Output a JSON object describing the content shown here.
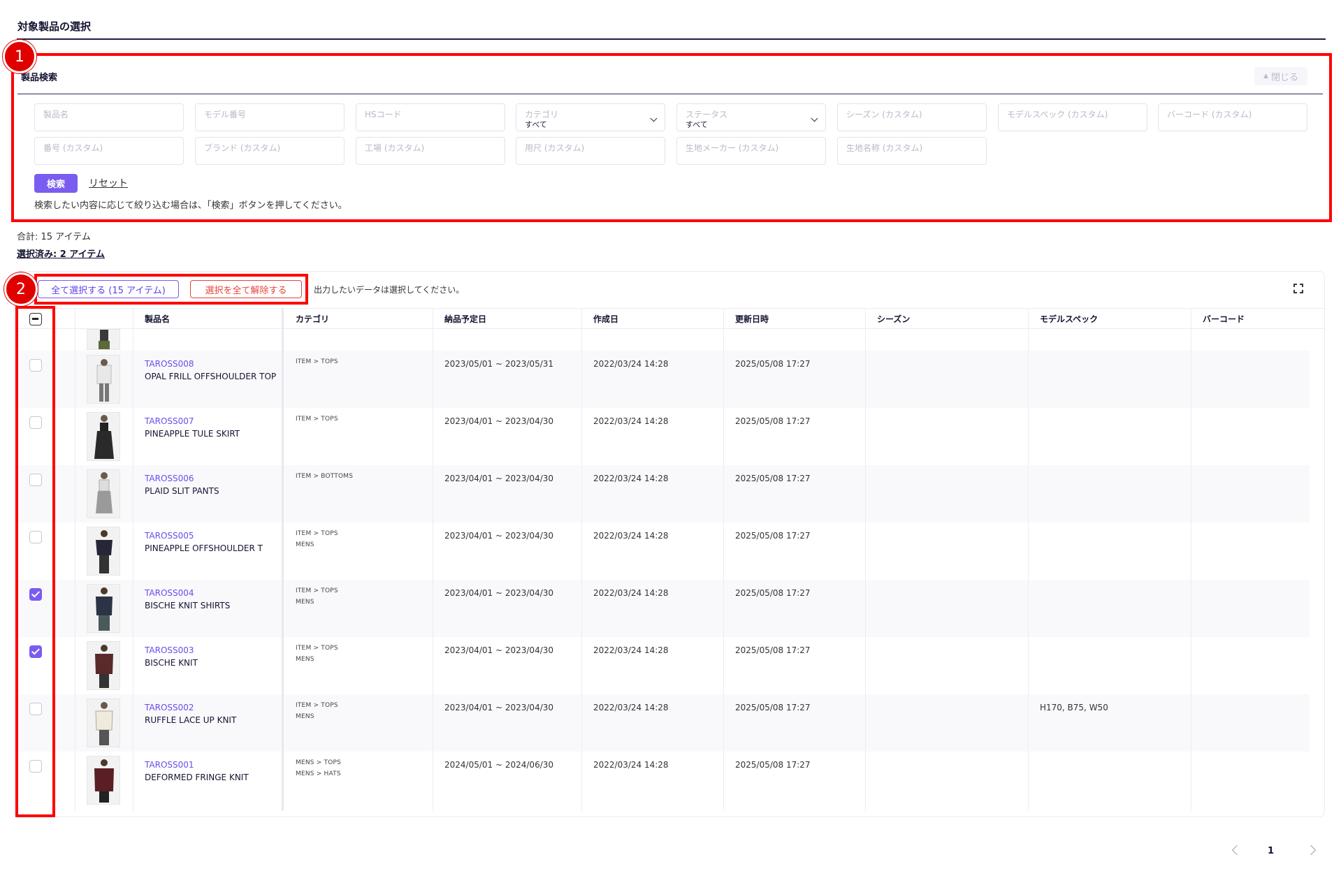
{
  "page": {
    "title": "対象製品の選択"
  },
  "search": {
    "heading": "製品検索",
    "close_label": "閉じる",
    "fields": [
      {
        "placeholder": "製品名"
      },
      {
        "placeholder": "モデル番号"
      },
      {
        "placeholder": "HSコード"
      },
      {
        "placeholder": "カテゴリ",
        "value": "すべて"
      },
      {
        "placeholder": "ステータス",
        "value": "すべて"
      },
      {
        "placeholder": "シーズン (カスタム)"
      },
      {
        "placeholder": "モデルスペック (カスタム)"
      },
      {
        "placeholder": "バーコード (カスタム)"
      },
      {
        "placeholder": "番号 (カスタム)"
      },
      {
        "placeholder": "ブランド (カスタム)"
      },
      {
        "placeholder": "工場 (カスタム)"
      },
      {
        "placeholder": "用尺 (カスタム)"
      },
      {
        "placeholder": "生地メーカー (カスタム)"
      },
      {
        "placeholder": "生地名称 (カスタム)"
      }
    ],
    "search_label": "検索",
    "reset_label": "リセット",
    "hint": "検索したい内容に応じて絞り込む場合は、「検索」ボタンを押してください。"
  },
  "summary": {
    "total": "合計: 15 アイテム",
    "selected": "選択済み: 2 アイテム"
  },
  "toolbar": {
    "select_all_label": "全て選択する (15 アイテム)",
    "deselect_all_label": "選択を全て解除する",
    "hint": "出力したいデータは選択してください。"
  },
  "table": {
    "headers": [
      "製品名",
      "カテゴリ",
      "納品予定日",
      "作成日",
      "更新日時",
      "シーズン",
      "モデルスペック",
      "バーコード"
    ],
    "rows": [
      {
        "code": "TAROSS008",
        "name": "OPAL FRILL OFFSHOULDER TOP",
        "cat1": "ITEM > TOPS",
        "cat2": "",
        "delivery": "2023/05/01 ~ 2023/05/31",
        "created": "2022/03/24 14:28",
        "updated": "2025/05/08 17:27",
        "season": "",
        "spec": "",
        "barcode": "",
        "checked": false
      },
      {
        "code": "TAROSS007",
        "name": "PINEAPPLE TULE SKIRT",
        "cat1": "ITEM > TOPS",
        "cat2": "",
        "delivery": "2023/04/01 ~ 2023/04/30",
        "created": "2022/03/24 14:28",
        "updated": "2025/05/08 17:27",
        "season": "",
        "spec": "",
        "barcode": "",
        "checked": false
      },
      {
        "code": "TAROSS006",
        "name": "PLAID SLIT PANTS",
        "cat1": "ITEM > BOTTOMS",
        "cat2": "",
        "delivery": "2023/04/01 ~ 2023/04/30",
        "created": "2022/03/24 14:28",
        "updated": "2025/05/08 17:27",
        "season": "",
        "spec": "",
        "barcode": "",
        "checked": false
      },
      {
        "code": "TAROSS005",
        "name": "PINEAPPLE OFFSHOULDER T",
        "cat1": "ITEM > TOPS",
        "cat2": "MENS",
        "delivery": "2023/04/01 ~ 2023/04/30",
        "created": "2022/03/24 14:28",
        "updated": "2025/05/08 17:27",
        "season": "",
        "spec": "",
        "barcode": "",
        "checked": false
      },
      {
        "code": "TAROSS004",
        "name": "BISCHE KNIT SHIRTS",
        "cat1": "ITEM > TOPS",
        "cat2": "MENS",
        "delivery": "2023/04/01 ~ 2023/04/30",
        "created": "2022/03/24 14:28",
        "updated": "2025/05/08 17:27",
        "season": "",
        "spec": "",
        "barcode": "",
        "checked": true
      },
      {
        "code": "TAROSS003",
        "name": "BISCHE KNIT",
        "cat1": "ITEM > TOPS",
        "cat2": "MENS",
        "delivery": "2023/04/01 ~ 2023/04/30",
        "created": "2022/03/24 14:28",
        "updated": "2025/05/08 17:27",
        "season": "",
        "spec": "",
        "barcode": "",
        "checked": true
      },
      {
        "code": "TAROSS002",
        "name": "RUFFLE LACE UP KNIT",
        "cat1": "ITEM > TOPS",
        "cat2": "MENS",
        "delivery": "2023/04/01 ~ 2023/04/30",
        "created": "2022/03/24 14:28",
        "updated": "2025/05/08 17:27",
        "season": "",
        "spec": "H170, B75, W50",
        "barcode": "",
        "checked": false
      },
      {
        "code": "TAROSS001",
        "name": "DEFORMED FRINGE KNIT",
        "cat1": "MENS > TOPS",
        "cat2": "MENS > HATS",
        "delivery": "2024/05/01 ~ 2024/06/30",
        "created": "2022/03/24 14:28",
        "updated": "2025/05/08 17:27",
        "season": "",
        "spec": "",
        "barcode": "",
        "checked": false
      }
    ]
  },
  "pagination": {
    "current": "1"
  },
  "annotations": {
    "badge1": "1",
    "badge2": "2",
    "color": "#ff0000"
  },
  "colors": {
    "accent": "#7b5cf0",
    "danger": "#e5443a",
    "link": "#6a4cea"
  }
}
